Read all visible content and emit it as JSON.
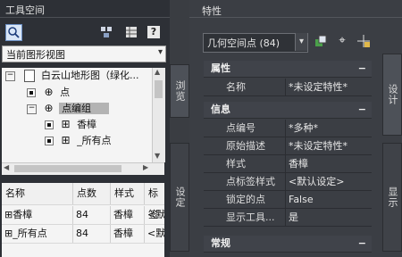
{
  "left": {
    "title": "工具空间",
    "view_select": "当前图形视图",
    "tree": [
      {
        "label": "白云山地形图（绿化...",
        "level": 0
      },
      {
        "label": "点",
        "level": 1
      },
      {
        "label": "点编组",
        "level": 1
      },
      {
        "label": "香樟",
        "level": 2
      },
      {
        "label": "_所有点",
        "level": 2
      }
    ],
    "tab_browse": "浏览",
    "tab_settings": "设定",
    "grid": {
      "headers": [
        "名称",
        "点数",
        "样式",
        "标签"
      ],
      "rows": [
        [
          "香樟",
          "84",
          "香樟",
          "<默"
        ],
        [
          "_所有点",
          "84",
          "香樟",
          "<默"
        ]
      ]
    }
  },
  "right": {
    "title": "特性",
    "selector": "几何空间点 (84)",
    "sections": {
      "props": "属性",
      "info": "信息",
      "general": "常规"
    },
    "rows_props": [
      {
        "k": "名称",
        "v": "*未设定特性*"
      }
    ],
    "rows_info": [
      {
        "k": "点编号",
        "v": "*多种*"
      },
      {
        "k": "原始描述",
        "v": "*未设定特性*"
      },
      {
        "k": "样式",
        "v": "香樟"
      },
      {
        "k": "点标签样式",
        "v": "<默认设定>"
      },
      {
        "k": "锁定的点",
        "v": "False"
      },
      {
        "k": "显示工具...",
        "v": "是"
      }
    ],
    "tab_design": "设计",
    "tab_display": "显示"
  },
  "colors": {
    "accent": "#6b8fc4",
    "panel_dark": "#2d3036"
  }
}
